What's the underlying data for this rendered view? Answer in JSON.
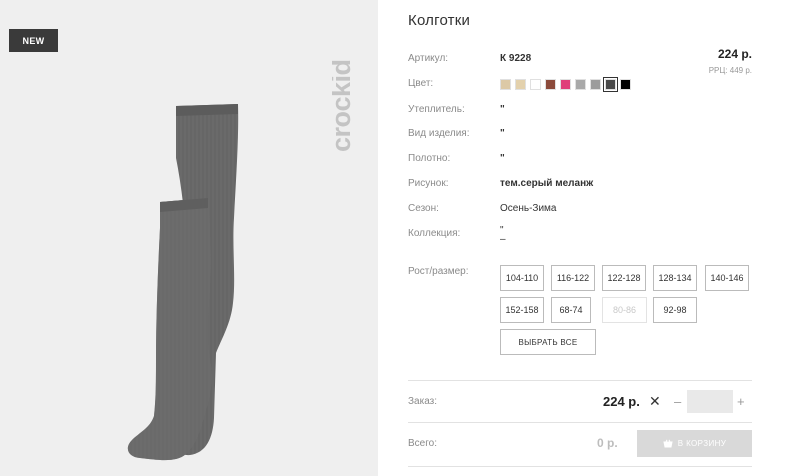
{
  "badge": "NEW",
  "brand": "crockid",
  "product": {
    "title": "Колготки",
    "price": "224 р.",
    "rrp": "РРЦ: 449 р."
  },
  "attributes": [
    {
      "label": "Артикул:",
      "value": "К 9228"
    },
    {
      "label": "Цвет:",
      "value": ""
    },
    {
      "label": "Утеплитель:",
      "value": "\""
    },
    {
      "label": "Вид изделия:",
      "value": "\""
    },
    {
      "label": "Полотно:",
      "value": "\""
    },
    {
      "label": "Рисунок:",
      "value": "тем.серый меланж"
    },
    {
      "label": "Сезон:",
      "value": "Осень-Зима"
    },
    {
      "label": "Коллекция:",
      "value": "\""
    }
  ],
  "colors": [
    "#dcc9a6",
    "#e3d1ad",
    "#ffffff",
    "#8b4a3a",
    "#e0407a",
    "#a9a9a9",
    "#9c9c9c",
    "#4a4a4a",
    "#000000"
  ],
  "selected_color_index": 7,
  "size_label": "Рост/размер:",
  "sizes": [
    {
      "label": "104-110",
      "disabled": false
    },
    {
      "label": "116-122",
      "disabled": false
    },
    {
      "label": "122-128",
      "disabled": false
    },
    {
      "label": "128-134",
      "disabled": false
    },
    {
      "label": "140-146",
      "disabled": false
    },
    {
      "label": "152-158",
      "disabled": false
    },
    {
      "label": "68-74",
      "disabled": false
    },
    {
      "label": "80-86",
      "disabled": true
    },
    {
      "label": "92-98",
      "disabled": false
    }
  ],
  "select_all": "ВЫБРАТЬ ВСЕ",
  "order": {
    "label": "Заказ:",
    "price": "224 р.",
    "times": "✕",
    "minus": "–",
    "plus": "+"
  },
  "total": {
    "label": "Всего:",
    "value": "0 р."
  },
  "cart_button": "В КОРЗИНУ"
}
